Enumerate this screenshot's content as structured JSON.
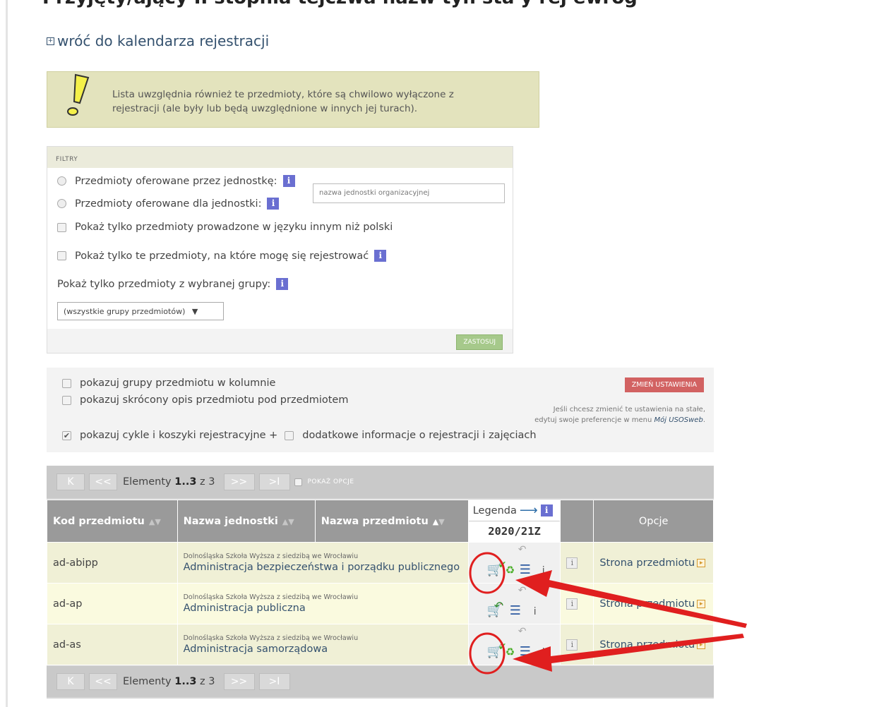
{
  "page": {
    "heading": "Przyjęty/ający II stopnia tejczwa nazw  tyn sta    y rej ewrog"
  },
  "back_link": {
    "label": "wróć do kalendarza rejestracji"
  },
  "notice": {
    "line1": "Lista uwzględnia również te przedmioty, które są chwilowo wyłączone z",
    "line2": "rejestracji (ale były lub będą uwzględnione w innych jej turach)."
  },
  "filters": {
    "title": "FILTRY",
    "radio_offered_by": "Przedmioty oferowane przez jednostkę:",
    "radio_offered_for": "Przedmioty oferowane dla jednostki:",
    "unit_placeholder": "nazwa jednostki organizacyjnej",
    "chk_foreign_language": "Pokaż tylko przedmioty prowadzone w języku innym niż polski",
    "chk_can_register": "Pokaż tylko te przedmioty, na które mogę się rejestrować",
    "group_label": "Pokaż tylko przedmioty z wybranej grupy:",
    "group_selected": "(wszystkie grupy przedmiotów)",
    "apply_label": "ZASTOSUJ",
    "info_glyph": "i"
  },
  "settings": {
    "chk_groups_column": "pokazuj grupy przedmiotu w kolumnie",
    "chk_short_desc": "pokazuj skrócony opis przedmiotu pod przedmiotem",
    "chk_cycles": "pokazuj cykle i koszyki rejestracyjne +",
    "chk_extra_info": "dodatkowe informacje o rejestracji i zajęciach",
    "change_settings": "ZMIEŃ USTAWIENIA",
    "pref_note_line1": "Jeśli chcesz zmienić te ustawienia na stałe,",
    "pref_note_line2_a": "edytuj swoje preferencje w menu ",
    "pref_note_line2_b": "Mój USOSweb",
    "pref_note_line2_c": "."
  },
  "pager": {
    "first": "K",
    "prev": "<<",
    "next": ">>",
    "last": ">I",
    "elements_label": "Elementy",
    "range": "1..3",
    "of": "z 3",
    "show_options": "POKAŻ OPCJE"
  },
  "table": {
    "col_code": "Kod przedmiotu",
    "col_unit": "Nazwa jednostki",
    "col_subject": "Nazwa przedmiotu",
    "legend_label": "Legenda",
    "legend_cycle": "2020/21Z",
    "col_options": "Opcje",
    "sort_up": "▲",
    "sort_down": "▼",
    "rows": [
      {
        "code": "ad-abipp",
        "unit": "Dolnośląska Szkoła Wyższa z siedzibą we Wrocławiu",
        "subject": "Administracja bezpieczeństwa i porządku publicznego",
        "option": "Strona przedmiotu"
      },
      {
        "code": "ad-ap",
        "unit": "Dolnośląska Szkoła Wyższa z siedzibą we Wrocławiu",
        "subject": "Administracja publiczna",
        "option": "Strona przedmiotu"
      },
      {
        "code": "ad-as",
        "unit": "Dolnośląska Szkoła Wyższa z siedzibą we Wrocławiu",
        "subject": "Administracja samorządowa",
        "option": "Strona przedmiotu"
      }
    ]
  },
  "icons": {
    "cart_check": "cart-with-check-icon",
    "cart_undo": "cart-with-undo-arrow-icon",
    "cycle": "green-cycle-icon",
    "list": "list-icon",
    "info": "i",
    "undo": "undo-arrow-icon"
  },
  "colors": {
    "link": "#34516e",
    "info_badge": "#6a6fd1",
    "apply_button": "#a6c98b",
    "change_button": "#d26262",
    "notice_bg": "#e3e3bd",
    "table_header": "#9a9a9a",
    "annotation": "#e01f1f"
  }
}
